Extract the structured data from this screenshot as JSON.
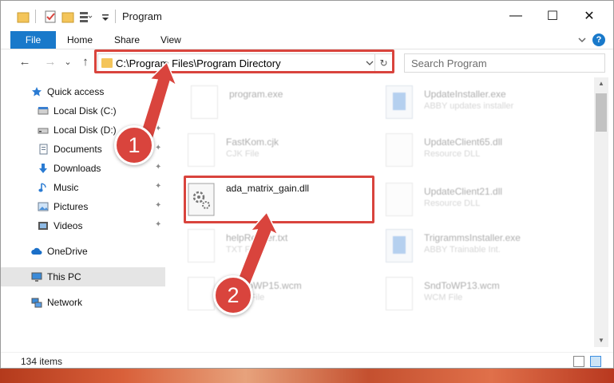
{
  "window": {
    "title": "Program",
    "controls": {
      "minimize": "—",
      "maximize": "☐",
      "close": "✕"
    }
  },
  "ribbon": {
    "tabs": [
      "File",
      "Home",
      "Share",
      "View"
    ],
    "expand_icon": "chevron-down-icon",
    "help": "?"
  },
  "navigation": {
    "back": "←",
    "forward": "→",
    "recent": "⌄",
    "up": "↑",
    "address": "C:\\Program Files\\Program Directory",
    "refresh": "↻",
    "search_placeholder": "Search Program",
    "search_icon": "⌕"
  },
  "sidebar": {
    "items": [
      {
        "label": "Quick access",
        "icon": "star-icon",
        "pinned": false
      },
      {
        "label": "Local Disk (C:)",
        "icon": "drive-icon",
        "pinned": true
      },
      {
        "label": "Local Disk (D:)",
        "icon": "drive-icon",
        "pinned": true
      },
      {
        "label": "Documents",
        "icon": "documents-icon",
        "pinned": true
      },
      {
        "label": "Downloads",
        "icon": "download-icon",
        "pinned": true
      },
      {
        "label": "Music",
        "icon": "music-icon",
        "pinned": true
      },
      {
        "label": "Pictures",
        "icon": "pictures-icon",
        "pinned": true
      },
      {
        "label": "Videos",
        "icon": "videos-icon",
        "pinned": true
      },
      {
        "label": "OneDrive",
        "icon": "cloud-icon",
        "pinned": false
      },
      {
        "label": "This PC",
        "icon": "computer-icon",
        "pinned": false,
        "selected": true
      },
      {
        "label": "Network",
        "icon": "network-icon",
        "pinned": false
      }
    ],
    "pin_glyph": "📌"
  },
  "files": [
    {
      "name": "program.exe",
      "type": "",
      "icon": "program-exe-icon",
      "highlight": false
    },
    {
      "name": "UpdateInstaller.exe",
      "type": "ABBY updates installer",
      "icon": "installer-icon",
      "highlight": false
    },
    {
      "name": "FastKom.cjk",
      "type": "CJK File",
      "icon": "document-icon",
      "highlight": false
    },
    {
      "name": "UpdateClient65.dll",
      "type": "Resource DLL",
      "icon": "gear-file-icon",
      "highlight": false
    },
    {
      "name": "ada_matrix_gain.dll",
      "type": "",
      "icon": "gear-file-icon",
      "highlight": true
    },
    {
      "name": "UpdateClient21.dll",
      "type": "Resource DLL",
      "icon": "gear-file-icon",
      "highlight": false
    },
    {
      "name": "helpReader.txt",
      "type": "TXT File",
      "icon": "document-icon",
      "highlight": false
    },
    {
      "name": "TrigrammsInstaller.exe",
      "type": "ABBY Trainable Int.",
      "icon": "installer-icon",
      "highlight": false
    },
    {
      "name": "SndToWP15.wcm",
      "type": "WCM File",
      "icon": "document-icon",
      "highlight": false
    },
    {
      "name": "SndToWP13.wcm",
      "type": "WCM File",
      "icon": "document-icon",
      "highlight": false
    }
  ],
  "status": {
    "count": "134 items"
  },
  "callouts": [
    {
      "number": "1",
      "color": "#d9443d"
    },
    {
      "number": "2",
      "color": "#d9443d"
    }
  ],
  "colors": {
    "accent": "#1979ca",
    "callout": "#d9443d",
    "selected": "#e5e5e5"
  }
}
